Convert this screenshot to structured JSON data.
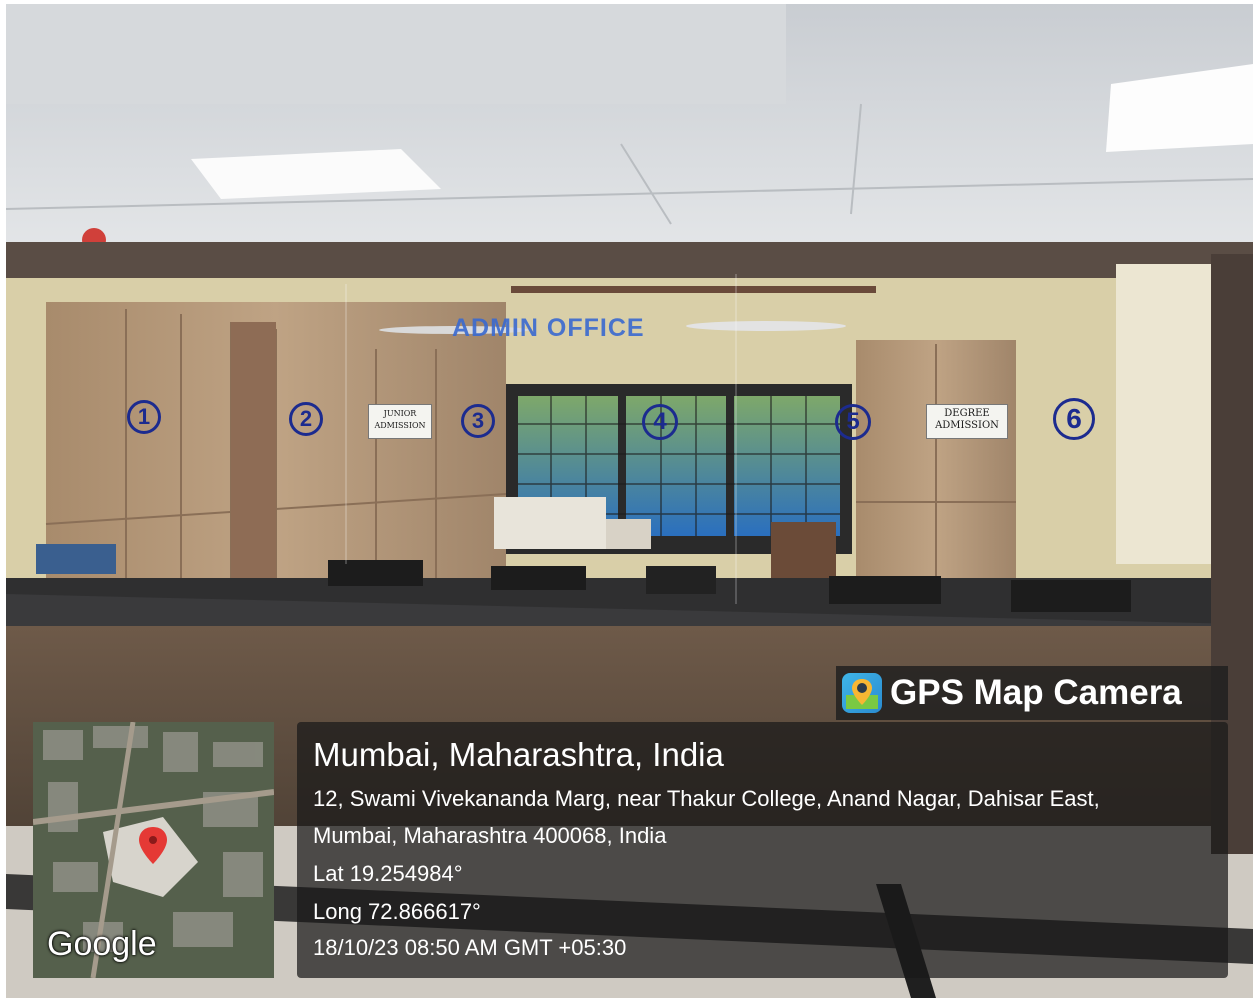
{
  "scene": {
    "office_sign": "ADMIN OFFICE",
    "counters": [
      "1",
      "2",
      "3",
      "4",
      "5",
      "6"
    ],
    "signs": [
      {
        "line1": "JUNIOR",
        "line2": "ADMISSION"
      },
      {
        "line1": "DEGREE",
        "line2": "ADMISSION"
      }
    ]
  },
  "overlay": {
    "app_name": "GPS Map Camera",
    "city": "Mumbai, Maharashtra, India",
    "address_line1": "12, Swami Vivekananda Marg, near Thakur College, Anand Nagar, Dahisar East,",
    "address_line2": "Mumbai, Maharashtra 400068, India",
    "latitude": "Lat 19.254984°",
    "longitude": "Long 72.866617°",
    "datetime": "18/10/23 08:50 AM GMT +05:30",
    "map_label": "Google"
  },
  "colors": {
    "counter_number": "#1c2b8f",
    "office_sign": "#3a6ad0",
    "map_pin": "#e53935"
  }
}
